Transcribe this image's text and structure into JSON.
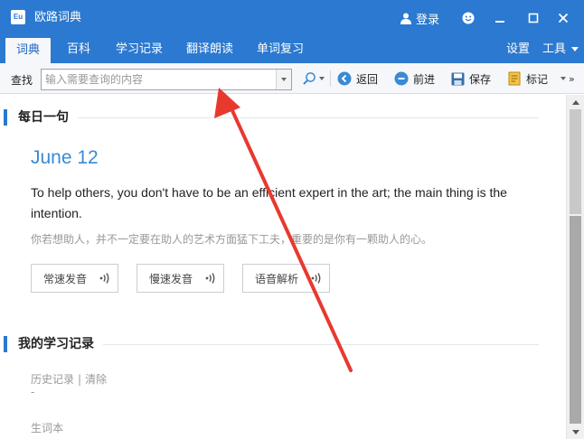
{
  "window": {
    "title": "欧路词典",
    "logo_text": "Eu",
    "login_label": "登录",
    "icons": [
      "user-icon",
      "smiley-icon",
      "minimize-icon",
      "maximize-icon",
      "close-icon"
    ]
  },
  "tabs": [
    {
      "label": "词典",
      "active": true
    },
    {
      "label": "百科",
      "active": false
    },
    {
      "label": "学习记录",
      "active": false
    },
    {
      "label": "翻译朗读",
      "active": false
    },
    {
      "label": "单词复习",
      "active": false
    }
  ],
  "tab_right": {
    "settings": "设置",
    "tools": "工具"
  },
  "toolbar": {
    "find_label": "查找",
    "search_placeholder": "输入需要查询的内容",
    "search_value": "",
    "back": "返回",
    "forward": "前进",
    "save": "保存",
    "mark": "标记"
  },
  "daily": {
    "heading": "每日一句",
    "date": "June 12",
    "quote_en": "To help others, you don't have to be an efficient expert in the art; the main thing is the intention.",
    "quote_cn": "你若想助人，并不一定要在助人的艺术方面猛下工夫，重要的是你有一颗助人的心。",
    "buttons": {
      "normal": "常速发音",
      "slow": "慢速发音",
      "analysis": "语音解析"
    }
  },
  "study": {
    "heading": "我的学习记录",
    "history": "历史记录",
    "separator": "|",
    "clear": "清除",
    "history_value": "-",
    "vocab": "生词本"
  },
  "colors": {
    "accent": "#2b79d0",
    "date": "#3a8ad4",
    "annotation": "#e8392f"
  }
}
